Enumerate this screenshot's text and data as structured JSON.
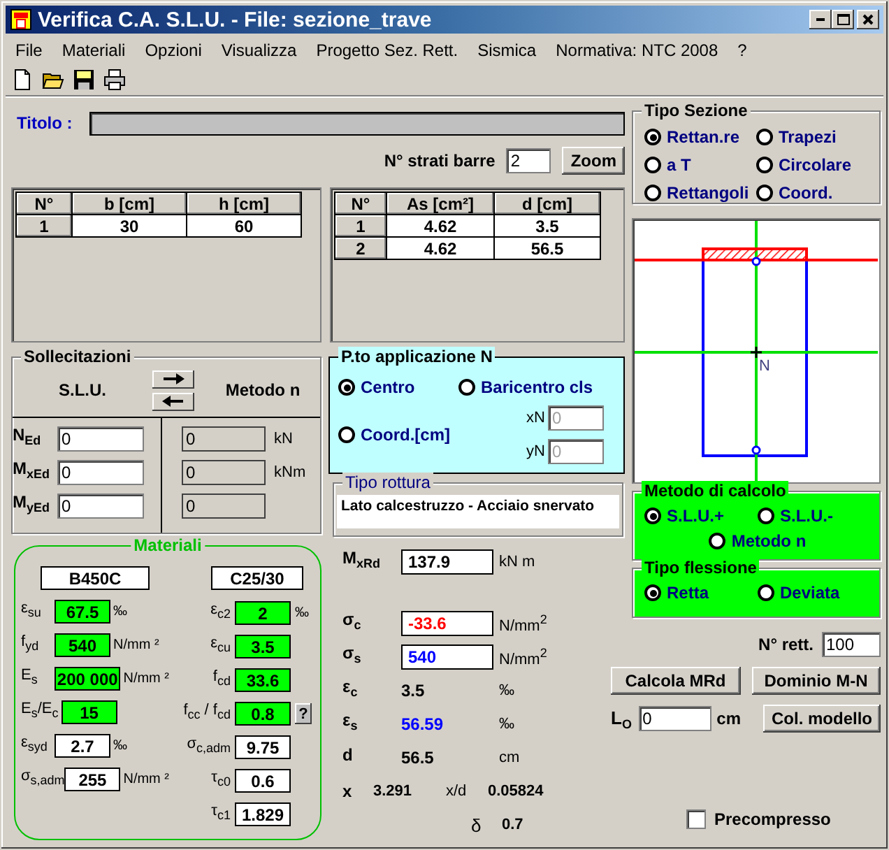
{
  "window": {
    "title": "Verifica C.A. S.L.U. - File: sezione_trave"
  },
  "menu": [
    "File",
    "Materiali",
    "Opzioni",
    "Visualizza",
    "Progetto Sez. Rett.",
    "Sismica",
    "Normativa: NTC 2008",
    "?"
  ],
  "toolbar": [
    {
      "kind": "new"
    },
    {
      "kind": "open"
    },
    {
      "kind": "save"
    },
    {
      "kind": "print"
    }
  ],
  "titolo": {
    "label": "Titolo :"
  },
  "strati": {
    "label": "N° strati barre",
    "value": "2",
    "button": "Zoom"
  },
  "section_table": {
    "columns": [
      "N°",
      "b [cm]",
      "h [cm]"
    ],
    "rows": [
      [
        "1",
        "30",
        "60"
      ]
    ]
  },
  "bars_table": {
    "columns": [
      "N°",
      "As [cm²]",
      "d [cm]"
    ],
    "rows": [
      [
        "1",
        "4.62",
        "3.5"
      ],
      [
        "2",
        "4.62",
        "56.5"
      ]
    ]
  },
  "sollecitazioni": {
    "title": "Sollecitazioni",
    "slu_heading": "S.L.U.",
    "metodo_heading": "Metodo n",
    "rows": [
      {
        "label": "N$_{Ed}$",
        "slu": "0",
        "metodo": "0",
        "unit": "kN"
      },
      {
        "label": "M$_{xEd}$",
        "slu": "0",
        "metodo": "0",
        "unit": "kNm"
      },
      {
        "label": "M$_{yEd}$",
        "slu": "0",
        "metodo": "0"
      }
    ]
  },
  "applicazione": {
    "title": "P.to applicazione N",
    "options": [
      {
        "label": "Centro",
        "selected": true
      },
      {
        "label": "Baricentro cls",
        "selected": false
      },
      {
        "label": "Coord.[cm]",
        "selected": false
      }
    ],
    "fields": [
      {
        "label": "xN",
        "value": "0",
        "disabled": true
      },
      {
        "label": "yN",
        "value": "0",
        "disabled": true
      }
    ]
  },
  "tipo_rottura": {
    "title": "Tipo rottura",
    "value": "Lato calcestruzzo - Acciaio snervato"
  },
  "tipo_sezione": {
    "title": "Tipo Sezione",
    "options": [
      {
        "label": "Rettan.re",
        "selected": true
      },
      {
        "label": "Trapezi",
        "selected": false
      },
      {
        "label": "a T",
        "selected": false
      },
      {
        "label": "Circolare",
        "selected": false
      },
      {
        "label": "Rettangoli",
        "selected": false
      },
      {
        "label": "Coord.",
        "selected": false
      }
    ]
  },
  "section_drawing": {
    "centroid_label": "N"
  },
  "metodo_calcolo": {
    "title": "Metodo di calcolo",
    "options": [
      {
        "label": "S.L.U.+",
        "selected": true
      },
      {
        "label": "S.L.U.-",
        "selected": false
      },
      {
        "label": "Metodo n",
        "selected": false
      }
    ]
  },
  "tipo_flessione": {
    "title": "Tipo flessione",
    "options": [
      {
        "label": "Retta",
        "selected": true
      },
      {
        "label": "Deviata",
        "selected": false
      }
    ]
  },
  "materiali": {
    "title": "Materiali",
    "steel": "B450C",
    "concrete": "C25/30",
    "steel_rows": [
      {
        "label": "ε$_{su}$",
        "value": "67.5",
        "unit": "‰",
        "highlighted": true
      },
      {
        "label": "f$_{yd}$",
        "value": "540",
        "unit": "N/mm ²",
        "highlighted": true
      },
      {
        "label": "E$_{s}$",
        "value": "200 000",
        "unit": "N/mm ²",
        "highlighted": true
      },
      {
        "label": "E$_{s}$/E$_{c}$",
        "value": "15",
        "highlighted": true
      },
      {
        "label": "ε$_{syd}$",
        "value": "2.7",
        "unit": "‰",
        "highlighted": false
      },
      {
        "label": "σ$_{s,adm}$",
        "value": "255",
        "unit": "N/mm ²",
        "highlighted": false
      }
    ],
    "concrete_rows": [
      {
        "label": "ε$_{c2}$",
        "value": "2",
        "unit": "‰",
        "highlighted": true
      },
      {
        "label": "ε$_{cu}$",
        "value": "3.5",
        "highlighted": true
      },
      {
        "label": "f$_{cd}$",
        "value": "33.6",
        "highlighted": true
      },
      {
        "label": "f$_{cc}$ / f$_{cd}$",
        "value": "0.8",
        "highlighted": true,
        "button": "?"
      },
      {
        "label": "σ$_{c,adm}$",
        "value": "9.75",
        "highlighted": false
      },
      {
        "label": "τ$_{c0}$",
        "value": "0.6",
        "highlighted": false
      },
      {
        "label": "τ$_{c1}$",
        "value": "1.829",
        "highlighted": false
      }
    ]
  },
  "results": {
    "moment": {
      "label": "M$_{xRd}$",
      "value": "137.9",
      "unit": "kN m"
    },
    "rows": [
      {
        "kind": "field",
        "label": "σ$_{c}$",
        "value": "-33.6",
        "unit": "N/mm$^{2}$",
        "color": "#ff0000"
      },
      {
        "kind": "field",
        "label": "σ$_{s}$",
        "value": "540",
        "unit": "N/mm$^{2}$",
        "color": "#0000ff"
      },
      {
        "kind": "plain",
        "label": "ε$_{c}$",
        "value": "3.5",
        "unit": "‰",
        "color": "#000000"
      },
      {
        "kind": "plain",
        "label": "ε$_{s}$",
        "value": "56.59",
        "unit": "‰",
        "color": "#0000ff"
      },
      {
        "kind": "plain",
        "label": "d",
        "value": "56.5",
        "unit": "cm",
        "color": "#000000"
      }
    ],
    "x": {
      "label": "x",
      "value": "3.291"
    },
    "xd": {
      "label": "x/d",
      "value": "0.05824"
    },
    "delta": {
      "label": "δ",
      "value": "0.7"
    }
  },
  "n_rett": {
    "label": "N° rett.",
    "value": "100"
  },
  "buttons": [
    "Calcola MRd",
    "Dominio M-N"
  ],
  "lo": {
    "label": "L$_{O}$",
    "value": "0",
    "unit": "cm"
  },
  "col_button": "Col. modello",
  "precompresso": {
    "label": "Precompresso",
    "checked": false
  }
}
